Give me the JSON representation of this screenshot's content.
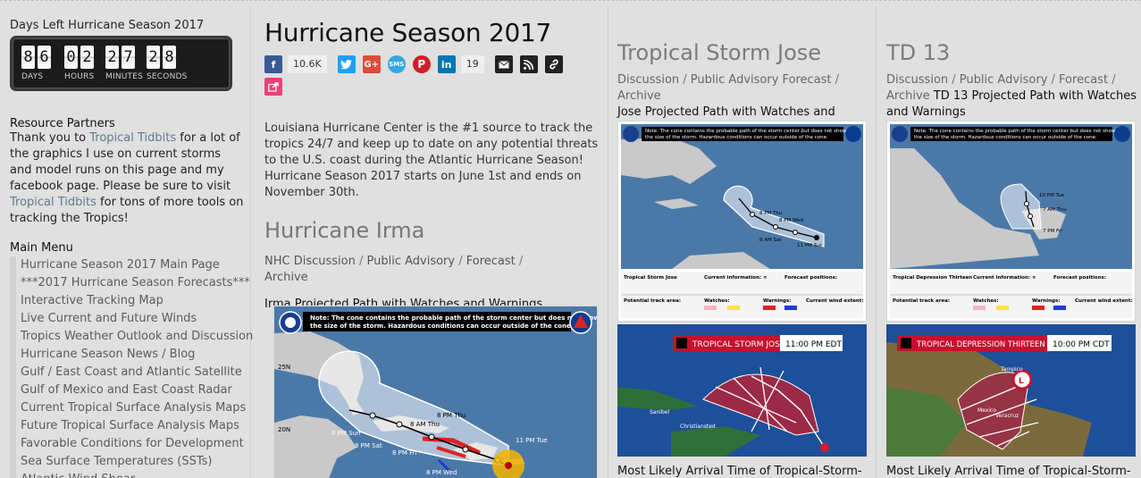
{
  "sidebar": {
    "countdown": {
      "title": "Days Left Hurricane Season 2017",
      "days": [
        "8",
        "6"
      ],
      "hours": [
        "0",
        "2"
      ],
      "minutes": [
        "2",
        "7"
      ],
      "seconds": [
        "2",
        "8"
      ],
      "labels": {
        "days": "DAYS",
        "hours": "HOURS",
        "minutes": "MINUTES",
        "seconds": "SECONDS"
      }
    },
    "partners": {
      "heading": "Resource Partners",
      "t1": "Thank you to ",
      "link1": "Tropical Tidbits",
      "t2": " for a lot of the graphics I use on current storms and model runs on this page and my facebook page. Please be sure to visit ",
      "link2": "Tropical Tidbits",
      "t3": " for tons of more tools on tracking the Tropics!"
    },
    "menu_heading": "Main Menu",
    "menu": [
      "Hurricane Season 2017 Main Page",
      "***2017 Hurricane Season Forecasts***",
      "Interactive Tracking Map",
      "Live Current and Future Winds",
      "Tropics Weather Outlook and Discussion",
      "Hurricane Season News / Blog",
      "Gulf / East Coast and Atlantic Satellite",
      "Gulf of Mexico and East Coast Radar",
      "Current Tropical Surface Analysis Maps",
      "Future Tropical Surface Analysis Maps",
      "Favorable Conditions for Development",
      "Sea Surface Temperatures (SSTs)",
      "Atlantic Wind Shear"
    ]
  },
  "main": {
    "title": "Hurricane Season 2017",
    "share": {
      "facebook_count": "10.6K",
      "linkedin_count": "19",
      "icons": [
        "facebook-icon",
        "twitter-icon",
        "google-plus-icon",
        "sms-icon",
        "pinterest-icon",
        "linkedin-icon",
        "email-icon",
        "rss-icon",
        "link-icon",
        "share-icon"
      ],
      "colors": {
        "facebook": "#3b5998",
        "twitter": "#1da1f2",
        "google": "#dd4b39",
        "sms": "#35a8e0",
        "pinterest": "#cb2027",
        "linkedin": "#0077b5",
        "dark": "#222222",
        "share": "#ec407a"
      }
    },
    "intro": "Louisiana Hurricane Center is the #1 source to track the tropics 24/7 and keep up to date on any potential threats to the U.S. coast during the Atlantic Hurricane Season! Hurricane Season 2017 starts on June 1st and ends on November 30th.",
    "irma": {
      "heading": "Hurricane Irma",
      "links": [
        "NHC Discussion",
        "Public Advisory",
        "Forecast",
        "Archive"
      ],
      "caption": "Irma Projected Path with Watches and Warnings",
      "map_note": "Note: The cone contains the probable path of the storm center but does not show the size of the storm. Hazardous conditions can occur outside of the cone.",
      "map_labels": [
        "8 PM Thu",
        "8 AM Thu",
        "8 PM Sun",
        "8 PM Sat",
        "8 PM Fri",
        "11 PM Tue",
        "8 PM Wed",
        "25N",
        "20N"
      ]
    }
  },
  "jose": {
    "heading": "Tropical Storm Jose",
    "links": [
      "Discussion",
      "Public Advisory Forecast",
      "Archive"
    ],
    "caption": "Jose Projected Path with Watches and Warnings",
    "banner_title": "TROPICAL STORM JOSE",
    "banner_time": "11:00 PM EDT",
    "bottom_caption": "Most Likely Arrival Time of Tropical-Storm-"
  },
  "td13": {
    "heading": "TD 13",
    "links": [
      "Discussion",
      "Public Advisory",
      "Forecast",
      "Archive"
    ],
    "caption": "TD 13 Projected Path with Watches and Warnings",
    "banner_title": "TROPICAL DEPRESSION THIRTEEN",
    "banner_time": "10:00 PM CDT",
    "bottom_caption": "Most Likely Arrival Time of Tropical-Storm-"
  }
}
